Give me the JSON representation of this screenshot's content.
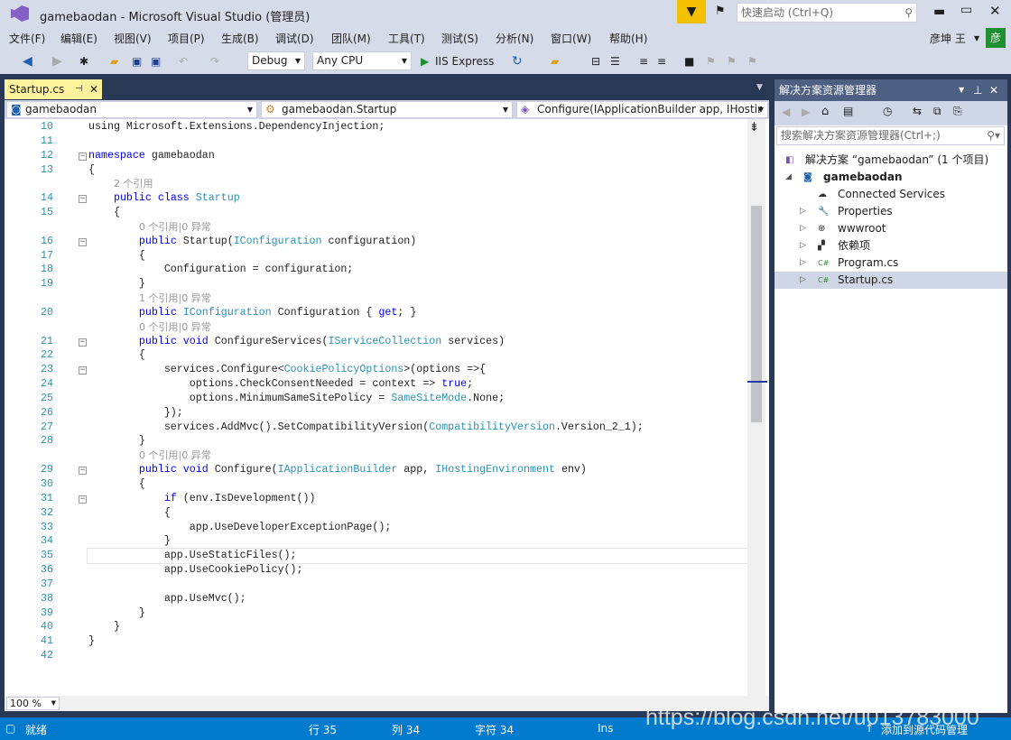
{
  "window": {
    "title": "gamebaodan - Microsoft Visual Studio (管理员)",
    "quick_launch_placeholder": "快速启动 (Ctrl+Q)",
    "user": "彦坤 王",
    "avatar_letter": "彦"
  },
  "menu": [
    "文件(F)",
    "编辑(E)",
    "视图(V)",
    "项目(P)",
    "生成(B)",
    "调试(D)",
    "团队(M)",
    "工具(T)",
    "测试(S)",
    "分析(N)",
    "窗口(W)",
    "帮助(H)"
  ],
  "toolbar": {
    "configuration": "Debug",
    "platform": "Any CPU",
    "run_target": "IIS Express"
  },
  "editor": {
    "tab": "Startup.cs",
    "nav_project": "gamebaodan",
    "nav_class": "gamebaodan.Startup",
    "nav_member": "Configure(IApplicationBuilder app, IHostir",
    "zoom": "100 %",
    "current_line": 35,
    "lines": [
      {
        "n": "10",
        "t": [
          [
            "",
            "using Microsoft.Extensions.DependencyInjection;"
          ]
        ]
      },
      {
        "n": "11",
        "t": []
      },
      {
        "n": "12",
        "f": 1,
        "t": [
          [
            "kw",
            "namespace"
          ],
          [
            "",
            " gamebaodan"
          ]
        ]
      },
      {
        "n": "13",
        "t": [
          [
            "",
            "{"
          ]
        ]
      },
      {
        "lens": "2 个引用",
        "i": 4
      },
      {
        "n": "14",
        "f": 1,
        "t": [
          [
            "",
            "    "
          ],
          [
            "kw",
            "public class"
          ],
          [
            "",
            " "
          ],
          [
            "ty",
            "Startup"
          ]
        ]
      },
      {
        "n": "15",
        "t": [
          [
            "",
            "    {"
          ]
        ]
      },
      {
        "lens": "0 个引用|0 异常",
        "i": 8
      },
      {
        "n": "16",
        "f": 1,
        "t": [
          [
            "",
            "        "
          ],
          [
            "kw",
            "public"
          ],
          [
            "",
            " Startup("
          ],
          [
            "ty",
            "IConfiguration"
          ],
          [
            "",
            " configuration)"
          ]
        ]
      },
      {
        "n": "17",
        "t": [
          [
            "",
            "        {"
          ]
        ]
      },
      {
        "n": "18",
        "t": [
          [
            "",
            "            Configuration = configuration;"
          ]
        ]
      },
      {
        "n": "19",
        "t": [
          [
            "",
            "        }"
          ]
        ]
      },
      {
        "lens": "1 个引用|0 异常",
        "i": 8
      },
      {
        "n": "20",
        "t": [
          [
            "",
            "        "
          ],
          [
            "kw",
            "public"
          ],
          [
            "",
            " "
          ],
          [
            "ty",
            "IConfiguration"
          ],
          [
            "",
            " Configuration { "
          ],
          [
            "kw",
            "get"
          ],
          [
            "",
            "; }"
          ]
        ]
      },
      {
        "lens": "0 个引用|0 异常",
        "i": 8
      },
      {
        "n": "21",
        "f": 1,
        "t": [
          [
            "",
            "        "
          ],
          [
            "kw",
            "public void"
          ],
          [
            "",
            " ConfigureServices("
          ],
          [
            "ty",
            "IServiceCollection"
          ],
          [
            "",
            " services)"
          ]
        ]
      },
      {
        "n": "22",
        "t": [
          [
            "",
            "        {"
          ]
        ]
      },
      {
        "n": "23",
        "f": 1,
        "t": [
          [
            "",
            "            services.Configure<"
          ],
          [
            "ty",
            "CookiePolicyOptions"
          ],
          [
            "",
            ">(options =>{"
          ]
        ]
      },
      {
        "n": "24",
        "t": [
          [
            "",
            "                options.CheckConsentNeeded = context => "
          ],
          [
            "kw",
            "true"
          ],
          [
            "",
            ";"
          ]
        ]
      },
      {
        "n": "25",
        "t": [
          [
            "",
            "                options.MinimumSameSitePolicy = "
          ],
          [
            "ty",
            "SameSiteMode"
          ],
          [
            "",
            ".None;"
          ]
        ]
      },
      {
        "n": "26",
        "t": [
          [
            "",
            "            });"
          ]
        ]
      },
      {
        "n": "27",
        "t": [
          [
            "",
            "            services.AddMvc().SetCompatibilityVersion("
          ],
          [
            "ty",
            "CompatibilityVersion"
          ],
          [
            "",
            ".Version_2_1);"
          ]
        ]
      },
      {
        "n": "28",
        "t": [
          [
            "",
            "        }"
          ]
        ]
      },
      {
        "lens": "0 个引用|0 异常",
        "i": 8
      },
      {
        "n": "29",
        "f": 1,
        "t": [
          [
            "",
            "        "
          ],
          [
            "kw",
            "public void"
          ],
          [
            "",
            " Configure("
          ],
          [
            "ty",
            "IApplicationBuilder"
          ],
          [
            "",
            " app, "
          ],
          [
            "ty",
            "IHostingEnvironment"
          ],
          [
            "",
            " env)"
          ]
        ]
      },
      {
        "n": "30",
        "t": [
          [
            "",
            "        {"
          ]
        ]
      },
      {
        "n": "31",
        "f": 1,
        "t": [
          [
            "",
            "            "
          ],
          [
            "kw",
            "if"
          ],
          [
            "",
            " (env.IsDevelopment())"
          ]
        ]
      },
      {
        "n": "32",
        "t": [
          [
            "",
            "            {"
          ]
        ]
      },
      {
        "n": "33",
        "t": [
          [
            "",
            "                app.UseDeveloperExceptionPage();"
          ]
        ]
      },
      {
        "n": "34",
        "t": [
          [
            "",
            "            }"
          ]
        ]
      },
      {
        "n": "35",
        "t": [
          [
            "",
            "            app.UseStaticFiles();"
          ]
        ]
      },
      {
        "n": "36",
        "t": [
          [
            "",
            "            app.UseCookiePolicy();"
          ]
        ]
      },
      {
        "n": "37",
        "t": []
      },
      {
        "n": "38",
        "t": [
          [
            "",
            "            app.UseMvc();"
          ]
        ]
      },
      {
        "n": "39",
        "t": [
          [
            "",
            "        }"
          ]
        ]
      },
      {
        "n": "40",
        "t": [
          [
            "",
            "    }"
          ]
        ]
      },
      {
        "n": "41",
        "t": [
          [
            "",
            "}"
          ]
        ]
      },
      {
        "n": "42",
        "t": []
      }
    ]
  },
  "solution_explorer": {
    "title": "解决方案资源管理器",
    "search_placeholder": "搜索解决方案资源管理器(Ctrl+;)",
    "items": [
      {
        "label": "解决方案 “gamebaodan” (1 个项目)",
        "icon": "solution-icon",
        "level": 0
      },
      {
        "label": "gamebaodan",
        "icon": "web-project-icon",
        "level": 1,
        "expanded": true,
        "bold": true
      },
      {
        "label": "Connected Services",
        "icon": "connected-services-icon",
        "level": 2
      },
      {
        "label": "Properties",
        "icon": "wrench-icon",
        "level": 2,
        "collapsed": true
      },
      {
        "label": "wwwroot",
        "icon": "globe-icon",
        "level": 2,
        "collapsed": true
      },
      {
        "label": "依赖项",
        "icon": "dependencies-icon",
        "level": 2,
        "collapsed": true
      },
      {
        "label": "Program.cs",
        "icon": "csharp-file-icon",
        "level": 2,
        "collapsed": true
      },
      {
        "label": "Startup.cs",
        "icon": "csharp-file-icon",
        "level": 2,
        "collapsed": true,
        "selected": true
      }
    ]
  },
  "status": {
    "ready": "就绪",
    "line": "行 35",
    "col": "列 34",
    "char": "字符 34",
    "mode": "Ins",
    "source_control": "添加到源代码管理",
    "watermark": "https://blog.csdn.net/u013783000"
  },
  "colors": {
    "accent": "#007acc",
    "keyword": "#0000ff",
    "type": "#2b91af",
    "tab_active": "#fff29d"
  }
}
